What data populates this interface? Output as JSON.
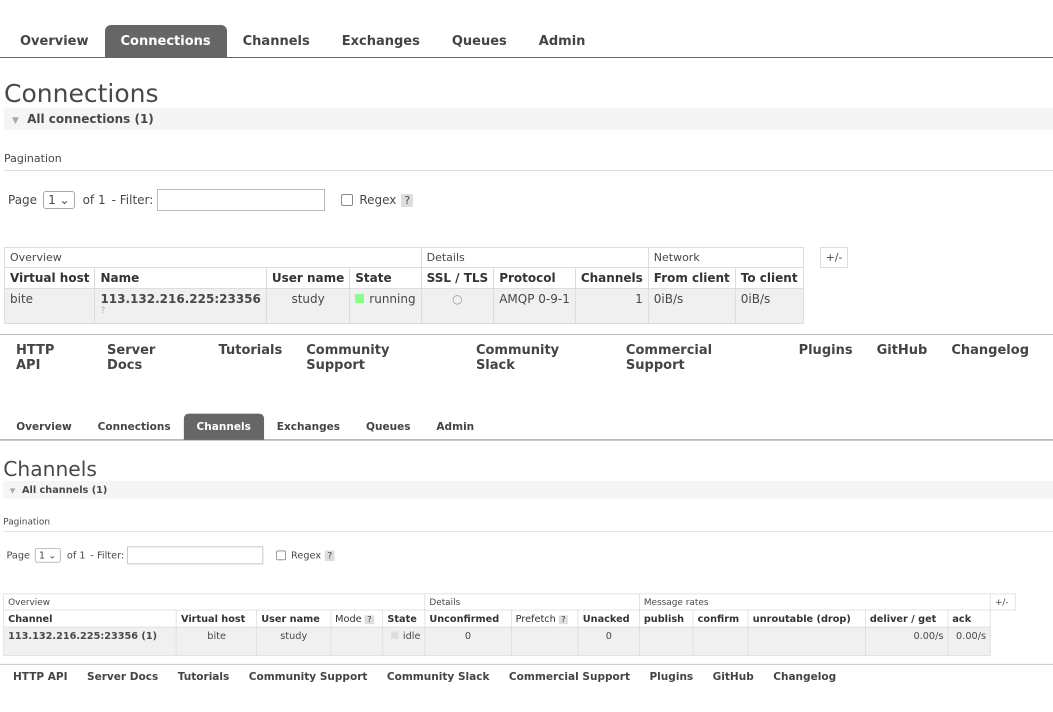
{
  "top": {
    "nav": [
      "Overview",
      "Connections",
      "Channels",
      "Exchanges",
      "Queues",
      "Admin"
    ],
    "title": "Connections",
    "section": "All connections (1)",
    "pagination_label": "Pagination",
    "page_label": "Page",
    "page_value": "1",
    "of_label": "of 1",
    "filter_label": "- Filter:",
    "regex_label": "Regex",
    "help": "?",
    "group_headers": [
      "Overview",
      "Details",
      "Network"
    ],
    "plus_minus": "+/-",
    "columns": [
      "Virtual host",
      "Name",
      "User name",
      "State",
      "SSL / TLS",
      "Protocol",
      "Channels",
      "From client",
      "To client"
    ],
    "row": {
      "vhost": "bite",
      "name": "113.132.216.225:23356",
      "name_sub": "?",
      "user": "study",
      "state": "running",
      "ssl": "○",
      "protocol": "AMQP 0-9-1",
      "channels": "1",
      "from_client": "0iB/s",
      "to_client": "0iB/s"
    },
    "footer": [
      "HTTP API",
      "Server Docs",
      "Tutorials",
      "Community Support",
      "Community Slack",
      "Commercial Support",
      "Plugins",
      "GitHub",
      "Changelog"
    ]
  },
  "bottom": {
    "nav": [
      "Overview",
      "Connections",
      "Channels",
      "Exchanges",
      "Queues",
      "Admin"
    ],
    "title": "Channels",
    "section": "All channels (1)",
    "pagination_label": "Pagination",
    "page_label": "Page",
    "page_value": "1",
    "of_label": "of 1",
    "filter_label": "- Filter:",
    "regex_label": "Regex",
    "help": "?",
    "group_headers": [
      "Overview",
      "Details",
      "Message rates"
    ],
    "plus_minus": "+/-",
    "columns": [
      "Channel",
      "Virtual host",
      "User name",
      "Mode",
      "State",
      "Unconfirmed",
      "Prefetch",
      "Unacked",
      "publish",
      "confirm",
      "unroutable (drop)",
      "deliver / get",
      "ack"
    ],
    "row": {
      "channel": "113.132.216.225:23356 (1)",
      "vhost": "bite",
      "user": "study",
      "mode": "",
      "state": "idle",
      "unconfirmed": "0",
      "prefetch": "",
      "unacked": "0",
      "publish": "",
      "confirm": "",
      "unroutable": "",
      "deliver_get": "0.00/s",
      "ack": "0.00/s"
    },
    "footer": [
      "HTTP API",
      "Server Docs",
      "Tutorials",
      "Community Support",
      "Community Slack",
      "Commercial Support",
      "Plugins",
      "GitHub",
      "Changelog"
    ]
  }
}
